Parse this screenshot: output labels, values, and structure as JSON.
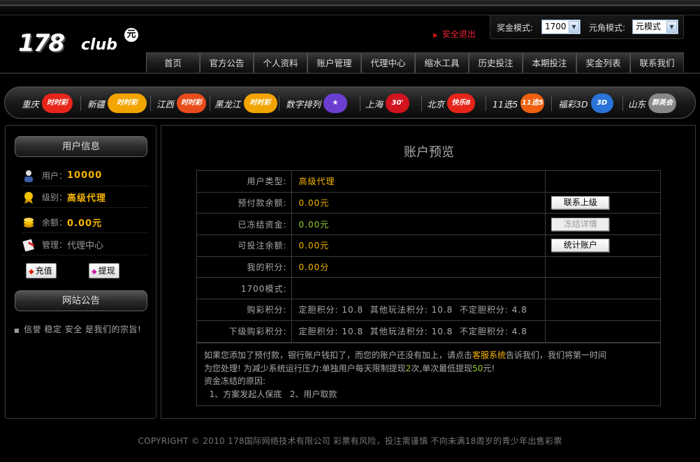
{
  "header": {
    "logo_text": "178",
    "logo_club": "club",
    "logo_badge": "元",
    "logout": "安全退出",
    "prize_mode_label": "奖金模式:",
    "prize_mode_value": "1700",
    "unit_mode_label": "元角模式:",
    "unit_mode_value": "元模式"
  },
  "nav": [
    "首页",
    "官方公告",
    "个人资料",
    "账户管理",
    "代理中心",
    "缩水工具",
    "历史投注",
    "本期投注",
    "奖金列表",
    "联系我们"
  ],
  "lotteries": [
    {
      "name": "重庆",
      "badge": "时时彩",
      "color": "#e8251a"
    },
    {
      "name": "新疆",
      "badge": "时时彩",
      "color": "#f2a400"
    },
    {
      "name": "江西",
      "badge": "时时彩",
      "color": "#e84c1a"
    },
    {
      "name": "黑龙江",
      "badge": "时时彩",
      "color": "#f2a400"
    },
    {
      "name": "数字排列",
      "badge": "★",
      "color": "#6a3fd0"
    },
    {
      "name": "上海",
      "badge": "30'",
      "color": "#d2141e"
    },
    {
      "name": "北京",
      "badge": "快乐8",
      "color": "#e8251a"
    },
    {
      "name": "11选5",
      "badge": "11选5",
      "color": "#f06010"
    },
    {
      "name": "福彩3D",
      "badge": "3D",
      "color": "#2a74d9"
    },
    {
      "name": "山东",
      "badge": "群英会",
      "color": "#888"
    }
  ],
  "sidebar": {
    "user_info_title": "用户信息",
    "user_label": "用户：",
    "user_value": "10000",
    "level_label": "级别：",
    "level_value": "高级代理",
    "balance_label": "余额：",
    "balance_value": "0.00元",
    "manage_label": "管理：",
    "manage_value": "代理中心",
    "recharge": "充值",
    "withdraw": "提现",
    "notice_title": "网站公告",
    "notice_text": "信誉 稳定 安全 是我们的宗旨!"
  },
  "main": {
    "title": "账户预览",
    "rows": [
      {
        "label": "用户类型:",
        "value": "高级代理",
        "button": ""
      },
      {
        "label": "预付款余额:",
        "value": "0.00元",
        "button": "联系上级"
      },
      {
        "label": "已冻结资金:",
        "value": "0.00元",
        "button": "冻结详情"
      },
      {
        "label": "可投注余额:",
        "value": "0.00元",
        "button": "统计账户"
      },
      {
        "label": "我的积分:",
        "value": "0.00分",
        "button": ""
      },
      {
        "label": "1700模式:",
        "value": "",
        "button": ""
      },
      {
        "label": "购彩积分:",
        "value": "定胆积分: 10.8  其他玩法积分: 10.8  不定胆积分: 4.8",
        "button": ""
      },
      {
        "label": "下级购彩积分:",
        "value": "定胆积分: 10.8  其他玩法积分: 10.8  不定胆积分: 4.8",
        "button": ""
      }
    ],
    "info_line1_a": "如果您添加了预付款，银行账户钱扣了，而您的账户还没有加上，请点击",
    "info_line1_link": "客服系统",
    "info_line1_b": "告诉我们，我们将第一时间",
    "info_line2_a": "为您处理! 为减少系统运行压力:单独用户每天限制提现",
    "info_line2_n1": "2",
    "info_line2_b": "次,单次最低提现",
    "info_line2_n2": "50",
    "info_line2_c": "元!",
    "info_line3": "资金冻结的原因:",
    "info_line4": "  1、方案发起人保底   2、用户取款"
  },
  "footer": "COPYRIGHT © 2010 178国际网络技术有限公司 彩票有风险，投注需谨慎 不向未满18周岁的青少年出售彩票"
}
